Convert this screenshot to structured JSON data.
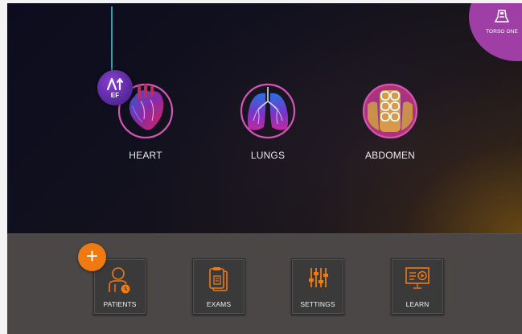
{
  "header": {
    "mode_badge": {
      "label": "TORSO ONE",
      "icon": "torso-probe-icon",
      "color": "#9f3fa6"
    },
    "ef_tool": {
      "label": "EF",
      "icon": "ef-measure-icon",
      "color": "#6a32b8"
    }
  },
  "organs": [
    {
      "label": "HEART",
      "icon": "heart-icon"
    },
    {
      "label": "LUNGS",
      "icon": "lungs-icon"
    },
    {
      "label": "ABDOMEN",
      "icon": "abdomen-icon"
    }
  ],
  "bottom_bar": {
    "add_button": {
      "label": "+",
      "icon": "plus-icon",
      "color": "#f07a12"
    },
    "tiles": [
      {
        "label": "PATIENTS",
        "icon": "patient-icon"
      },
      {
        "label": "EXAMS",
        "icon": "exams-clipboard-icon"
      },
      {
        "label": "SETTINGS",
        "icon": "sliders-icon"
      },
      {
        "label": "LEARN",
        "icon": "learn-presentation-icon"
      }
    ]
  },
  "colors": {
    "accent_orange": "#f07a12",
    "accent_purple": "#9f3fa6",
    "ring_pink": "#d455b4"
  }
}
